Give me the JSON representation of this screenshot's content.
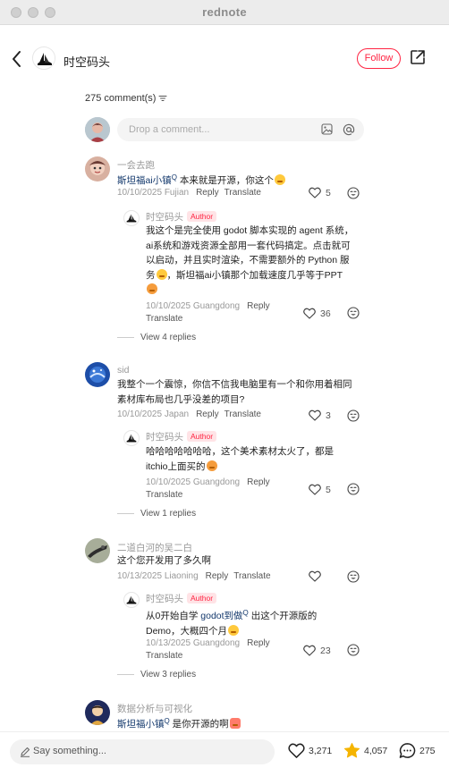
{
  "window": {
    "title": "rednote"
  },
  "header": {
    "author_name": "时空码头",
    "follow_label": "Follow"
  },
  "comments_header": {
    "count_label": "275 comment(s)"
  },
  "composer": {
    "placeholder": "Drop a comment..."
  },
  "comments": [
    {
      "user": "一会去跑",
      "mention": "斯坦福ai小镇",
      "text_after": " 本来就是开源，你这个",
      "date_loc": "10/10/2025 Fujian",
      "reply_label": "Reply",
      "translate_label": "Translate",
      "likes": "5",
      "reply": {
        "user": "时空码头",
        "badge": "Author",
        "line1": "我这个是完全使用 godot 脚本实现的 agent 系统，",
        "line2": "ai系统和游戏资源全部用一套代码搞定。点击就可",
        "line3": "以启动，并且实时渲染，不需要额外的 Python 服",
        "line4": "务",
        "line4b": "，斯坦福ai小镇那个加载速度几乎等于PPT",
        "date_loc": "10/10/2025 Guangdong",
        "reply_label": "Reply",
        "translate_label": "Translate",
        "likes": "36"
      },
      "view_replies": "View 4 replies"
    },
    {
      "user": "sid",
      "line1": "我整个一个震惊，你信不信我电脑里有一个和你用着相同",
      "line2": "素材库布局也几乎没差的项目?",
      "date_loc": "10/10/2025 Japan",
      "reply_label": "Reply",
      "translate_label": "Translate",
      "likes": "3",
      "reply": {
        "user": "时空码头",
        "badge": "Author",
        "line1": "哈哈哈哈哈哈哈，这个美术素材太火了，都是",
        "line2": "itchio上面买的",
        "date_loc": "10/10/2025 Guangdong",
        "reply_label": "Reply",
        "translate_label": "Translate",
        "likes": "5"
      },
      "view_replies": "View 1 replies"
    },
    {
      "user": "二道白河的吴二白",
      "line1": "这个您开发用了多久啊",
      "date_loc": "10/13/2025 Liaoning",
      "reply_label": "Reply",
      "translate_label": "Translate",
      "reply": {
        "user": "时空码头",
        "badge": "Author",
        "pre": "从0开始自学 ",
        "mention": "godot到做",
        "post": " 出这个开源版的",
        "line2": "Demo，大概四个月",
        "date_loc": "10/13/2025 Guangdong",
        "reply_label": "Reply",
        "translate_label": "Translate",
        "likes": "23"
      },
      "view_replies": "View 3 replies"
    },
    {
      "user": "数据分析与可视化",
      "mention": "斯坦福小镇",
      "text_after": " 是你开源的啊"
    }
  ],
  "bottom_bar": {
    "say_placeholder": "Say something...",
    "likes": "3,271",
    "stars": "4,057",
    "comments": "275"
  },
  "colors": {
    "accent": "#ff2442",
    "mention": "#13386c",
    "star": "#f5b400"
  }
}
